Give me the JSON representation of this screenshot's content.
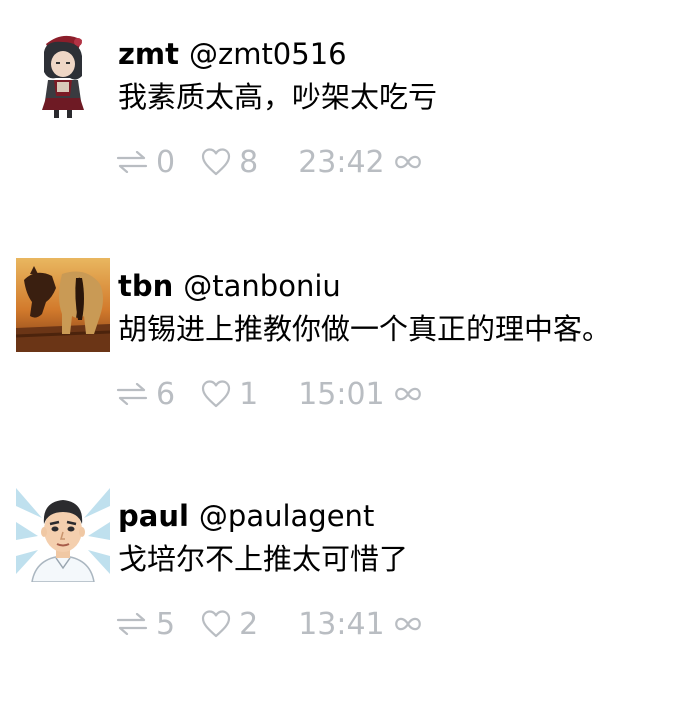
{
  "posts": [
    {
      "name": "zmt",
      "handle": "@zmt0516",
      "text": "我素质太高，吵架太吃亏",
      "reposts": "0",
      "likes": "8",
      "time": "23:42",
      "avatar_icon": "character-avatar"
    },
    {
      "name": "tbn",
      "handle": "@tanboniu",
      "text": "胡锡进上推教你做一个真正的理中客。",
      "reposts": "6",
      "likes": "1",
      "time": "15:01",
      "avatar_icon": "horse-sunset-avatar"
    },
    {
      "name": "paul",
      "handle": "@paulagent",
      "text": "戈培尔不上推太可惜了",
      "reposts": "5",
      "likes": "2",
      "time": "13:41",
      "avatar_icon": "cartoon-man-avatar"
    }
  ],
  "colors": {
    "meta_gray": "#b9bdc2",
    "text": "#000000",
    "background": "#ffffff"
  }
}
